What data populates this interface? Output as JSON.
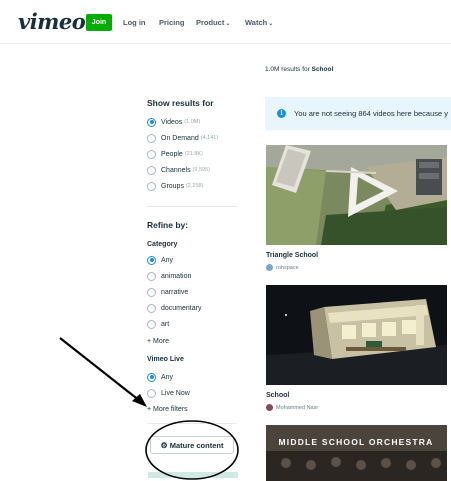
{
  "header": {
    "logo": "vimeo",
    "join_label": "Join",
    "nav": [
      {
        "label": "Log in",
        "has_dropdown": false
      },
      {
        "label": "Pricing",
        "has_dropdown": false
      },
      {
        "label": "Product",
        "has_dropdown": true
      },
      {
        "label": "Watch",
        "has_dropdown": true
      }
    ]
  },
  "results": {
    "count_prefix": "1.0M results for",
    "query": "School"
  },
  "sidebar": {
    "show_results_title": "Show results for",
    "types": [
      {
        "label": "Videos",
        "count": "(1.0M)",
        "selected": true
      },
      {
        "label": "On Demand",
        "count": "(4,141)",
        "selected": false
      },
      {
        "label": "People",
        "count": "(21.8K)",
        "selected": false
      },
      {
        "label": "Channels",
        "count": "(9,595)",
        "selected": false
      },
      {
        "label": "Groups",
        "count": "(2,258)",
        "selected": false
      }
    ],
    "refine_title": "Refine by:",
    "category_title": "Category",
    "categories": [
      {
        "label": "Any",
        "selected": true
      },
      {
        "label": "animation",
        "selected": false
      },
      {
        "label": "narrative",
        "selected": false
      },
      {
        "label": "documentary",
        "selected": false
      },
      {
        "label": "art",
        "selected": false
      }
    ],
    "more_label": "+ More",
    "live_title": "Vimeo Live",
    "live_options": [
      {
        "label": "Any",
        "selected": true
      },
      {
        "label": "Live Now",
        "selected": false
      }
    ],
    "more_filters_label": "+ More filters",
    "mature_label": "Mature content"
  },
  "notice": {
    "text": "You are not seeing 864 videos here because y"
  },
  "videos": [
    {
      "title": "Triangle School",
      "author": "rohspace"
    },
    {
      "title": "School",
      "author": "Mohammed Nasr"
    },
    {
      "title": "",
      "author": "",
      "overlay_text": "MIDDLE SCHOOL ORCHESTRA"
    }
  ],
  "colors": {
    "brand_green": "#00ad00",
    "accent_blue": "#1a8fdc",
    "text_dark": "#1a2e3b",
    "notice_bg": "#e8f5fc"
  },
  "icons": {
    "notice": "info-icon",
    "mature": "gear-icon",
    "dropdown": "chevron-down-icon"
  }
}
